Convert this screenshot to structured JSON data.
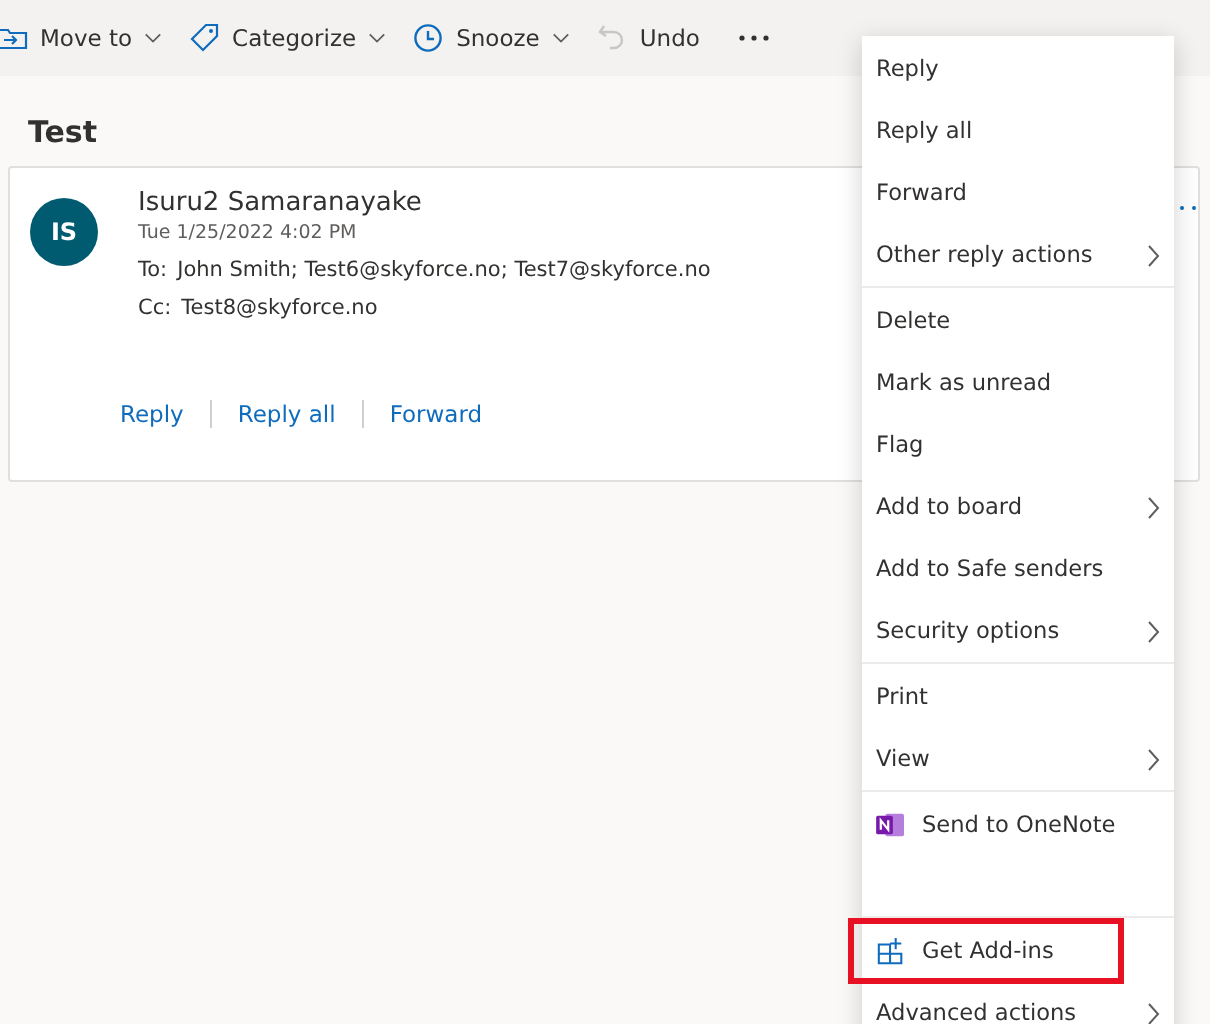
{
  "toolbar": [
    {
      "label": "Move to",
      "kind": "move",
      "dropdown": true
    },
    {
      "label": "Categorize",
      "kind": "tag",
      "dropdown": true
    },
    {
      "label": "Snooze",
      "kind": "clock",
      "dropdown": true
    },
    {
      "label": "Undo",
      "kind": "undo",
      "dropdown": false
    }
  ],
  "subject": "Test",
  "message": {
    "initials": "IS",
    "sender": "Isuru2 Samaranayake",
    "date": "Tue 1/25/2022 4:02 PM",
    "to_label": "To:",
    "to": "John Smith; Test6@skyforce.no; Test7@skyforce.no",
    "cc_label": "Cc:",
    "cc": "Test8@skyforce.no",
    "actions": [
      "Reply",
      "Reply all",
      "Forward"
    ]
  },
  "context_menu": {
    "groups": [
      [
        {
          "label": "Reply",
          "kind": "text",
          "submenu": false,
          "highlighted": false
        },
        {
          "label": "Reply all",
          "kind": "text",
          "submenu": false,
          "highlighted": false
        },
        {
          "label": "Forward",
          "kind": "text",
          "submenu": false,
          "highlighted": false
        },
        {
          "label": "Other reply actions",
          "kind": "text",
          "submenu": true,
          "highlighted": false
        }
      ],
      [
        {
          "label": "Delete",
          "kind": "text",
          "submenu": false,
          "highlighted": false
        },
        {
          "label": "Mark as unread",
          "kind": "text",
          "submenu": false,
          "highlighted": false
        },
        {
          "label": "Flag",
          "kind": "text",
          "submenu": false,
          "highlighted": false
        },
        {
          "label": "Add to board",
          "kind": "text",
          "submenu": true,
          "highlighted": false
        },
        {
          "label": "Add to Safe senders",
          "kind": "text",
          "submenu": false,
          "highlighted": false
        },
        {
          "label": "Security options",
          "kind": "text",
          "submenu": true,
          "highlighted": false
        }
      ],
      [
        {
          "label": "Print",
          "kind": "text",
          "submenu": false,
          "highlighted": false
        },
        {
          "label": "View",
          "kind": "text",
          "submenu": true,
          "highlighted": false
        }
      ],
      [
        {
          "label": "Send to OneNote",
          "kind": "onenote",
          "submenu": false,
          "highlighted": false
        }
      ],
      [
        {
          "label": "Get Add-ins",
          "kind": "addins",
          "submenu": false,
          "highlighted": true
        },
        {
          "label": "Advanced actions",
          "kind": "text",
          "submenu": true,
          "highlighted": false
        }
      ]
    ]
  }
}
